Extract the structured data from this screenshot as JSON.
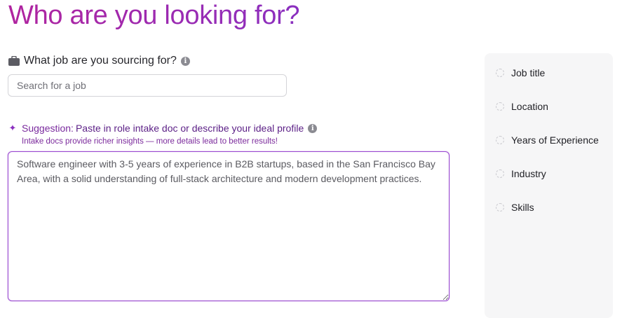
{
  "page": {
    "title": "Who are you looking for?"
  },
  "job_search": {
    "label": "What job are you sourcing for?",
    "placeholder": "Search for a job",
    "value": ""
  },
  "suggestion": {
    "prefix": "Suggestion:",
    "text": "Paste in role intake doc or describe your ideal profile",
    "hint": "Intake docs provide richer insights — more details lead to better results!"
  },
  "profile_description": {
    "value": "Software engineer with 3-5 years of experience in B2B startups, based in the San Francisco Bay Area, with a solid understanding of full-stack architecture and modern development practices."
  },
  "criteria": {
    "items": [
      {
        "label": "Job title"
      },
      {
        "label": "Location"
      },
      {
        "label": "Years of Experience"
      },
      {
        "label": "Industry"
      },
      {
        "label": "Skills"
      }
    ]
  },
  "icons": {
    "briefcase": "briefcase-icon",
    "info": "info-icon",
    "sparkle": "sparkle-icon"
  },
  "colors": {
    "title_gradient_start": "#b0249f",
    "title_gradient_end": "#8a2fbf",
    "accent_purple": "#9a4ad0",
    "suggestion_text": "#5b1f86",
    "panel_background": "#f6f6f7"
  }
}
